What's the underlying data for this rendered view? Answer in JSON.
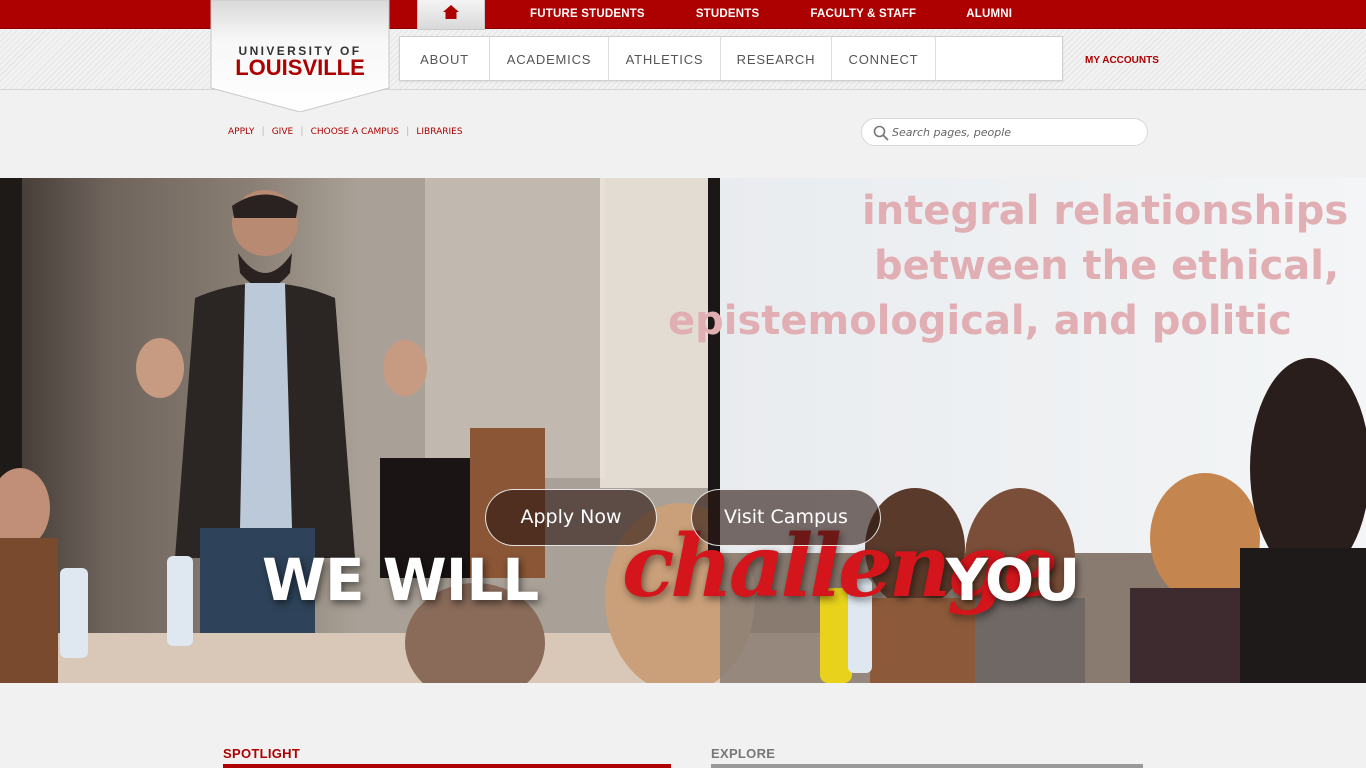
{
  "colors": {
    "brand_red": "#ad0000",
    "nav_text": "#555555",
    "page_bg": "#f1f1f1"
  },
  "top_nav": {
    "home_icon": "home-icon",
    "links": [
      "FUTURE STUDENTS",
      "STUDENTS",
      "FACULTY & STAFF",
      "ALUMNI"
    ]
  },
  "logo": {
    "line1": "UNIVERSITY OF",
    "line2": "LOUISVILLE"
  },
  "main_nav": {
    "items": [
      "ABOUT",
      "ACADEMICS",
      "ATHLETICS",
      "RESEARCH",
      "CONNECT"
    ],
    "my_accounts": "MY ACCOUNTS"
  },
  "utility_links": [
    "APPLY",
    "GIVE",
    "CHOOSE A CAMPUS",
    "LIBRARIES"
  ],
  "search": {
    "placeholder": "Search pages, people",
    "icon": "search-icon"
  },
  "hero": {
    "headline_part1": "WE WILL",
    "headline_script": "challenge",
    "headline_part2": "YOU",
    "screen_lines": [
      "integral relationships",
      "between the ethical,",
      "epistemological, and politic"
    ],
    "apply_button": "Apply Now",
    "visit_button": "Visit Campus"
  },
  "sections": {
    "spotlight": "SPOTLIGHT",
    "explore": "EXPLORE"
  }
}
